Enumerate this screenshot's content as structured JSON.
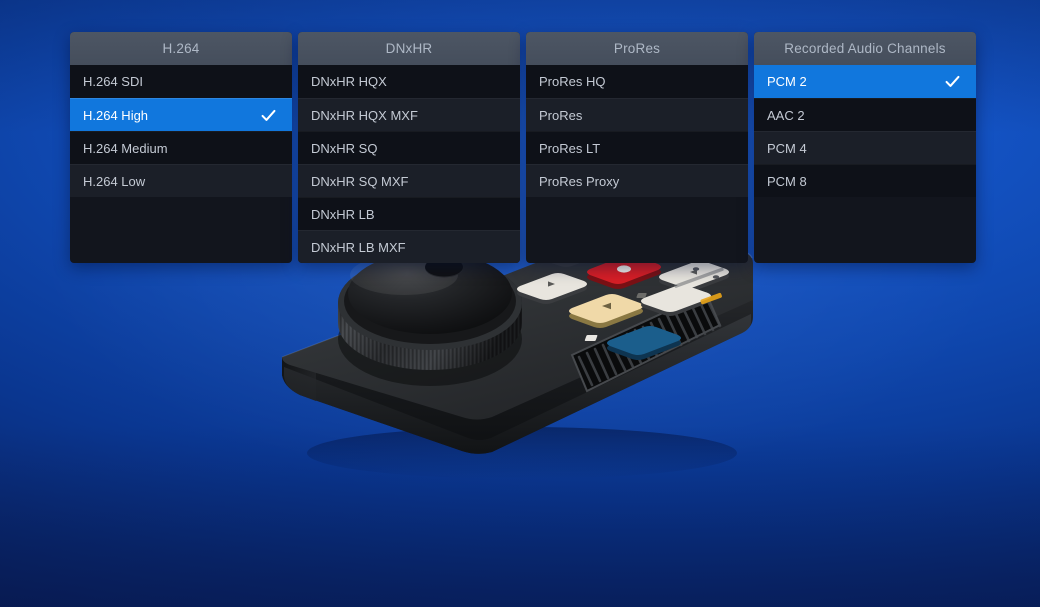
{
  "app": {
    "background_color": "#0f47ae",
    "accent_color": "#1177dd",
    "header_color": "#4a5362",
    "row_dark_color": "#0e1118",
    "row_light_color": "#1b1f28"
  },
  "panels": [
    {
      "id": "h264",
      "title": "H.264",
      "items": [
        {
          "label": "H.264 SDI",
          "selected": false
        },
        {
          "label": "H.264 High",
          "selected": true
        },
        {
          "label": "H.264 Medium",
          "selected": false
        },
        {
          "label": "H.264 Low",
          "selected": false
        }
      ]
    },
    {
      "id": "dnxhr",
      "title": "DNxHR",
      "items": [
        {
          "label": "DNxHR HQX",
          "selected": false
        },
        {
          "label": "DNxHR HQX MXF",
          "selected": false
        },
        {
          "label": "DNxHR SQ",
          "selected": false
        },
        {
          "label": "DNxHR SQ MXF",
          "selected": false
        },
        {
          "label": "DNxHR LB",
          "selected": false
        },
        {
          "label": "DNxHR LB MXF",
          "selected": false
        }
      ]
    },
    {
      "id": "prores",
      "title": "ProRes",
      "items": [
        {
          "label": "ProRes HQ",
          "selected": false
        },
        {
          "label": "ProRes",
          "selected": false
        },
        {
          "label": "ProRes LT",
          "selected": false
        },
        {
          "label": "ProRes Proxy",
          "selected": false
        }
      ]
    },
    {
      "id": "audio-channels",
      "title": "Recorded Audio Channels",
      "items": [
        {
          "label": "PCM 2",
          "selected": true
        },
        {
          "label": "AAC 2",
          "selected": false
        },
        {
          "label": "PCM 4",
          "selected": false
        },
        {
          "label": "PCM 8",
          "selected": false
        }
      ]
    }
  ],
  "device": {
    "name": "broadcast-recorder",
    "body_color": "#2b2d30",
    "jog_wheel": {
      "name": "jog-wheel",
      "color": "#1c1d1f"
    },
    "buttons": [
      {
        "name": "prev-clip-button",
        "color": "#e8e5de"
      },
      {
        "name": "next-clip-button",
        "color": "#e8e5de"
      },
      {
        "name": "record-button",
        "color": "#d81f26"
      },
      {
        "name": "play-button",
        "color": "#f0d9a8"
      },
      {
        "name": "skip-button",
        "color": "#e8e5de"
      },
      {
        "name": "stop-button",
        "color": "#1b5e8c"
      },
      {
        "name": "menu-button",
        "color": "#e8e5de"
      }
    ],
    "vent": {
      "name": "cooling-vent",
      "slat_count": 17
    }
  }
}
